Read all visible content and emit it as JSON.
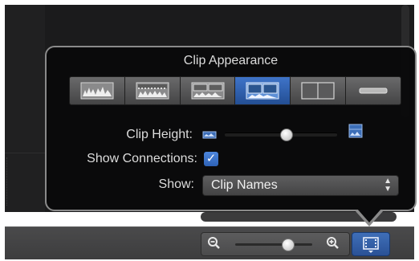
{
  "popover": {
    "title": "Clip Appearance",
    "appearance_buttons": [
      {
        "name": "waveforms-only",
        "selected": false
      },
      {
        "name": "large-waveforms",
        "selected": false
      },
      {
        "name": "waveforms-and-filmstrip",
        "selected": false
      },
      {
        "name": "large-filmstrip",
        "selected": true
      },
      {
        "name": "filmstrip-only",
        "selected": false
      },
      {
        "name": "clip-labels-only",
        "selected": false
      }
    ],
    "clip_height_label": "Clip Height:",
    "clip_height_value": 0.55,
    "show_connections_label": "Show Connections:",
    "show_connections_checked": true,
    "show_label": "Show:",
    "show_value": "Clip Names",
    "checkmark": "✓",
    "select_arrows": "▲▼"
  },
  "toolbar": {
    "zoom_out_icon": "zoom-out-icon",
    "zoom_in_icon": "zoom-in-icon",
    "zoom_level": 0.68,
    "clip_appearance_icon": "filmstrip-icon",
    "accent_color": "#2f62b6"
  }
}
